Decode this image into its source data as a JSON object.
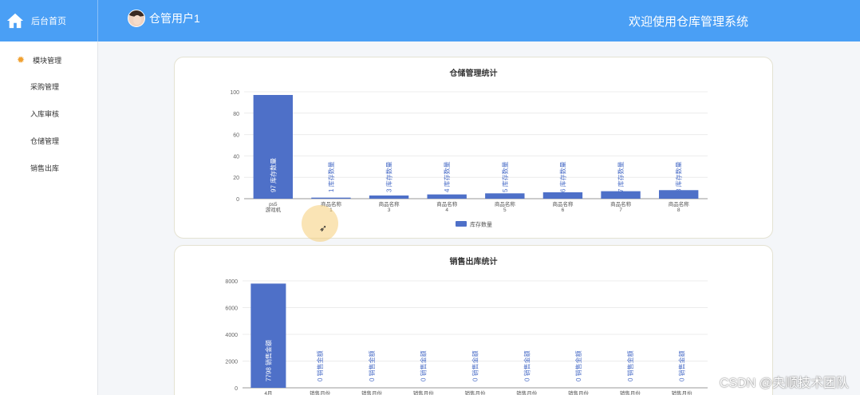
{
  "header": {
    "home_label": "后台首页",
    "user_name": "仓管用户1",
    "welcome": "欢迎使用仓库管理系统"
  },
  "sidebar": {
    "section": "模块管理",
    "items": [
      {
        "label": "采购管理"
      },
      {
        "label": "入库审核"
      },
      {
        "label": "仓储管理"
      },
      {
        "label": "销售出库"
      }
    ]
  },
  "colors": {
    "header": "#4a9ff5",
    "bar": "#4e70c8",
    "accent": "#f0a030"
  },
  "watermark": "CSDN @央顺技术团队",
  "chart_data": [
    {
      "type": "bar",
      "title": "仓储管理统计",
      "categories": [
        "ps5游戏机",
        "商品名称1",
        "商品名称3",
        "商品名称4",
        "商品名称5",
        "商品名称6",
        "商品名称7",
        "商品名称8"
      ],
      "series": [
        {
          "name": "库存数量",
          "values": [
            97,
            1,
            3,
            4,
            5,
            6,
            7,
            8
          ]
        }
      ],
      "ylim": [
        0,
        100
      ],
      "yticks": [
        0,
        20,
        40,
        60,
        80,
        100
      ],
      "legend": "bottom-center",
      "grid": true
    },
    {
      "type": "bar",
      "title": "销售出库统计",
      "categories": [
        "4月",
        "销售月份",
        "销售月份",
        "销售月份",
        "销售月份",
        "销售月份",
        "销售月份",
        "销售月份",
        "销售月份"
      ],
      "series": [
        {
          "name": "销售金额",
          "values": [
            7798,
            0,
            0,
            0,
            0,
            0,
            0,
            0,
            0
          ]
        }
      ],
      "ylim": [
        0,
        8000
      ],
      "yticks": [
        0,
        2000,
        4000,
        6000,
        8000
      ],
      "grid": true
    }
  ]
}
